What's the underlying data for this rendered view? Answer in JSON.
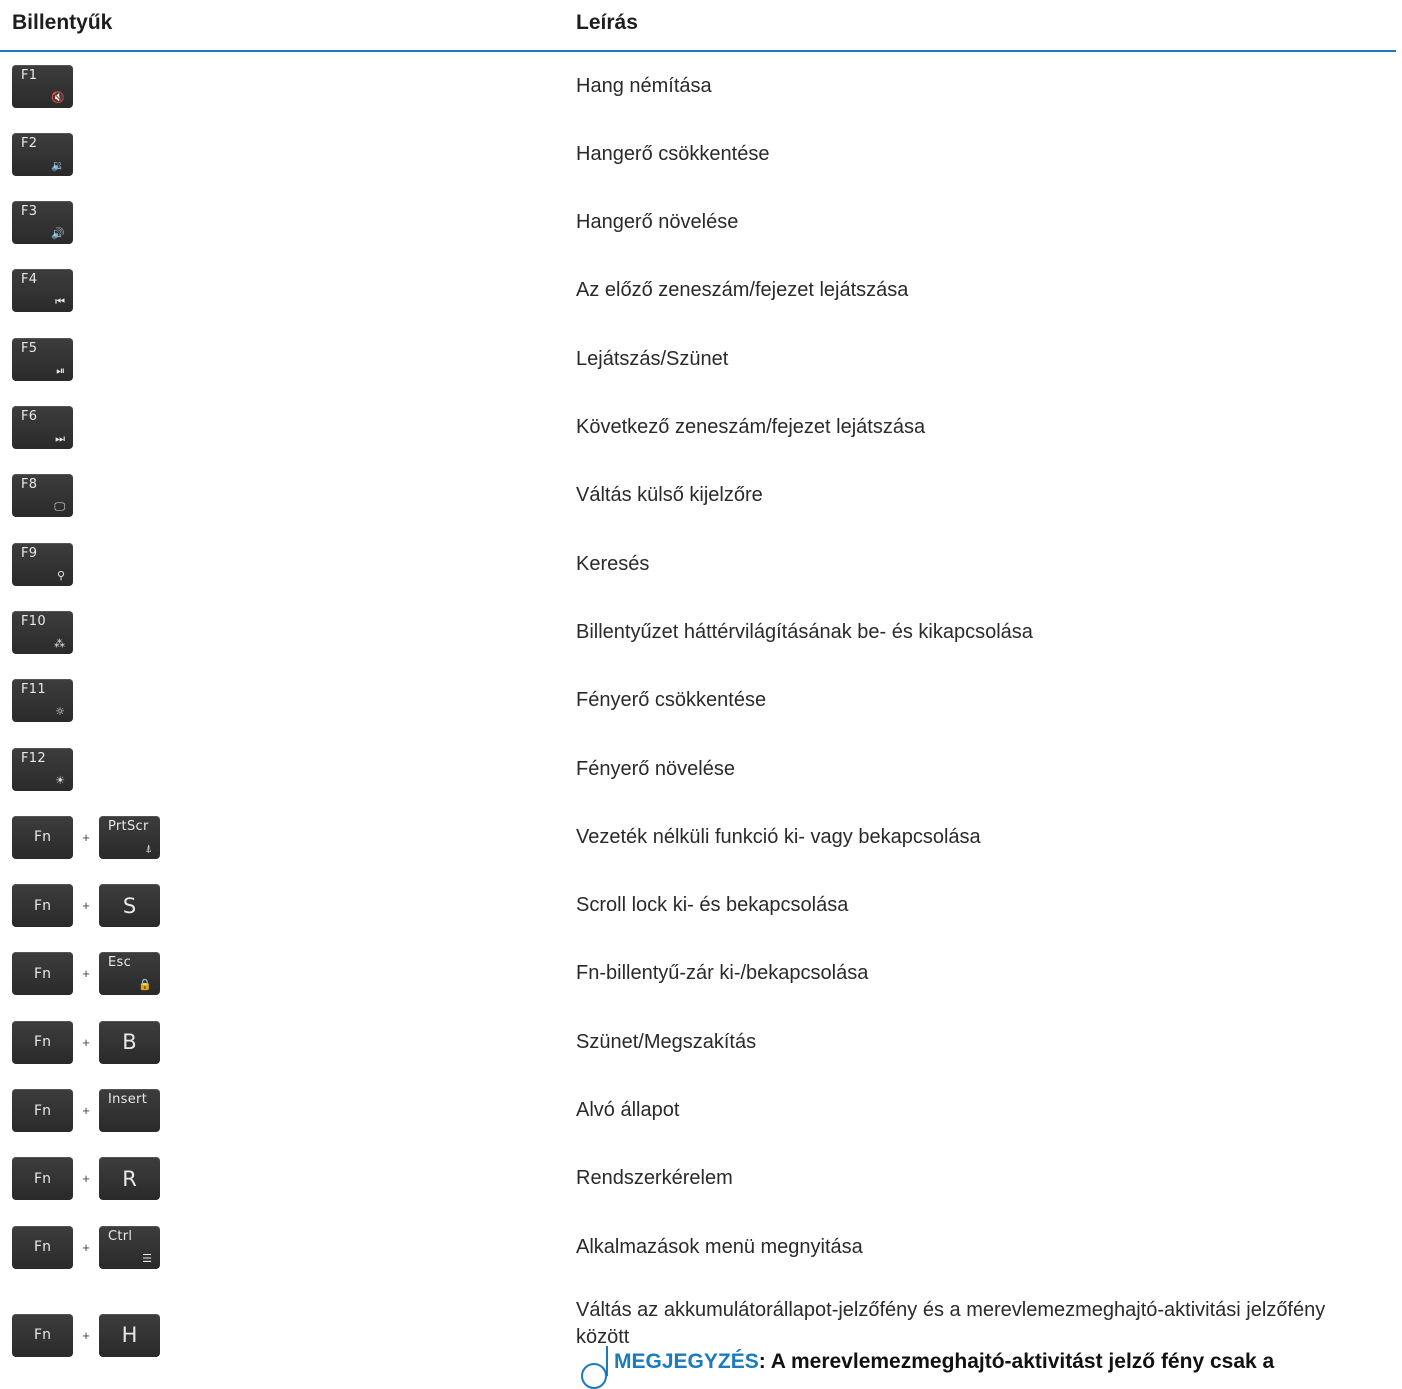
{
  "header": {
    "col_keys": "Billentyűk",
    "col_desc": "Leírás"
  },
  "rows": [
    {
      "keys": [
        {
          "label": "F1",
          "icon": "🔇"
        }
      ],
      "desc": "Hang némítása"
    },
    {
      "keys": [
        {
          "label": "F2",
          "icon": "🔉"
        }
      ],
      "desc": "Hangerő csökkentése"
    },
    {
      "keys": [
        {
          "label": "F3",
          "icon": "🔊"
        }
      ],
      "desc": "Hangerő növelése"
    },
    {
      "keys": [
        {
          "label": "F4",
          "icon": "⏮"
        }
      ],
      "desc": "Az előző zeneszám/fejezet lejátszása"
    },
    {
      "keys": [
        {
          "label": "F5",
          "icon": "⏯"
        }
      ],
      "desc": "Lejátszás/Szünet"
    },
    {
      "keys": [
        {
          "label": "F6",
          "icon": "⏭"
        }
      ],
      "desc": "Következő zeneszám/fejezet lejátszása"
    },
    {
      "keys": [
        {
          "label": "F8",
          "icon": "🖵"
        }
      ],
      "desc": "Váltás külső kijelzőre"
    },
    {
      "keys": [
        {
          "label": "F9",
          "icon": "⚲"
        }
      ],
      "desc": "Keresés"
    },
    {
      "keys": [
        {
          "label": "F10",
          "icon": "⁂"
        }
      ],
      "desc": "Billentyűzet háttérvilágításának be- és kikapcsolása"
    },
    {
      "keys": [
        {
          "label": "F11",
          "icon": "☼"
        }
      ],
      "desc": "Fényerő csökkentése"
    },
    {
      "keys": [
        {
          "label": "F12",
          "icon": "☀"
        }
      ],
      "desc": "Fényerő növelése"
    },
    {
      "keys": [
        {
          "label": "Fn",
          "center": true
        },
        {
          "label": "PrtScr",
          "icon": "⍋"
        }
      ],
      "desc": "Vezeték nélküli funkció ki- vagy bekapcsolása"
    },
    {
      "keys": [
        {
          "label": "Fn",
          "center": true
        },
        {
          "label": "S",
          "center": true,
          "big": true
        }
      ],
      "desc": "Scroll lock ki- és bekapcsolása"
    },
    {
      "keys": [
        {
          "label": "Fn",
          "center": true
        },
        {
          "label": "Esc",
          "icon": "🔒"
        }
      ],
      "desc": "Fn-billentyű-zár ki-/bekapcsolása"
    },
    {
      "keys": [
        {
          "label": "Fn",
          "center": true
        },
        {
          "label": "B",
          "center": true,
          "big": true
        }
      ],
      "desc": "Szünet/Megszakítás"
    },
    {
      "keys": [
        {
          "label": "Fn",
          "center": true
        },
        {
          "label": "Insert"
        }
      ],
      "desc": "Alvó állapot"
    },
    {
      "keys": [
        {
          "label": "Fn",
          "center": true
        },
        {
          "label": "R",
          "center": true,
          "big": true
        }
      ],
      "desc": "Rendszerkérelem"
    },
    {
      "keys": [
        {
          "label": "Fn",
          "center": true
        },
        {
          "label": "Ctrl",
          "icon": "☰"
        }
      ],
      "desc": "Alkalmazások menü megnyitása"
    }
  ],
  "plus": "+",
  "last_row": {
    "keys": [
      {
        "label": "Fn",
        "center": true
      },
      {
        "label": "H",
        "center": true,
        "big": true
      }
    ],
    "desc": "Váltás az akkumulátorállapot-jelzőfény és a merevlemezmeghajtó-aktivitási jelzőfény között",
    "note_label": "MEGJEGYZÉS",
    "note_text": ": A merevlemezmeghajtó-aktivitást jelző fény csak a"
  }
}
